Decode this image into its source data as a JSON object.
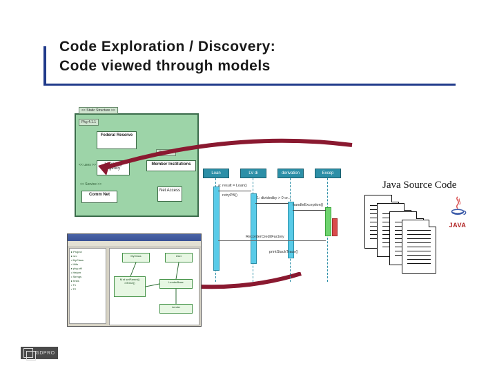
{
  "title": {
    "line1": "Code Exploration / Discovery:",
    "line2": "Code viewed through models"
  },
  "class_diagram": {
    "header_tag": "<< Static Structure >>",
    "sub_tag": "Pkg 4.1.1",
    "side_tag": "Pkg 4.1.2",
    "boxes": {
      "federal": "Federal\nReserve",
      "member": "Member Institutions",
      "licensing": "Licensing\nAgency",
      "comm": "Comm Net",
      "net": "Net\nAccess"
    },
    "assoc_labels": {
      "uses": "<< uses >>",
      "service": "<< Service >>"
    }
  },
  "sequence": {
    "heads": [
      "Loan",
      "LV di",
      "derivation",
      "Excep"
    ],
    "messages": [
      "a: result = Loan()",
      "retryPB()",
      "1: dividedby > 0 or...",
      "handleException()",
      "RecorderCreditFactory",
      "printStackTrace()"
    ]
  },
  "java": {
    "label": "Java Source Code",
    "logo_text": "JAVA"
  },
  "ide": {
    "tree": [
      "▸ Project",
      "  ▸ src",
      "    • MyClass",
      "    • Utils",
      "  ▸ pkg.util",
      "    • Helper",
      "    • Strings",
      "  ▸ tests",
      "    • T1",
      "    • T2"
    ],
    "nodes": {
      "a": "MyClass",
      "b": "User",
      "c": "M el\nsetParent()\nrefresh()",
      "d": "LenderBase",
      "e": "Lender"
    }
  },
  "footer": {
    "brand": "GDPRO"
  }
}
